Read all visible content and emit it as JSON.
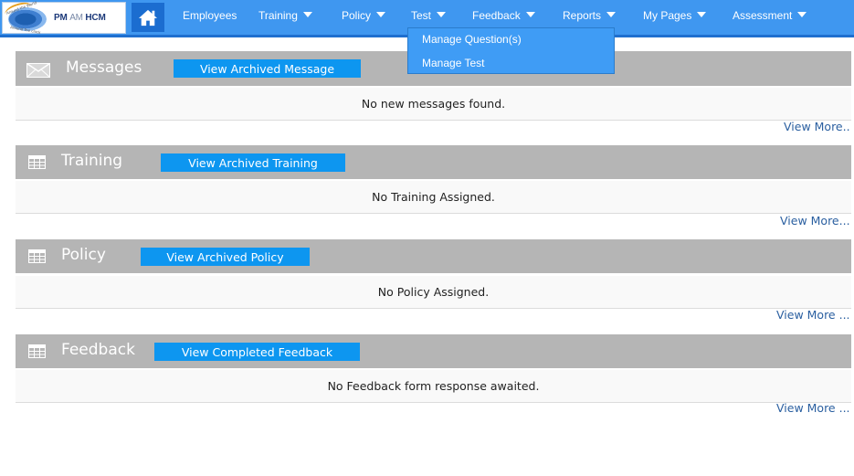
{
  "header": {
    "logo_text_a": "PM",
    "logo_text_b": "AM",
    "logo_text_c": "HCM",
    "logo_tagline_top": "Around the World",
    "logo_tagline_bottom": "Around the clock",
    "nav": [
      {
        "label": "Employees",
        "has_caret": false
      },
      {
        "label": "Training",
        "has_caret": true
      },
      {
        "label": "Policy",
        "has_caret": true
      },
      {
        "label": "Test",
        "has_caret": true
      },
      {
        "label": "Feedback",
        "has_caret": true
      },
      {
        "label": "Reports",
        "has_caret": true
      },
      {
        "label": "My Pages",
        "has_caret": true
      },
      {
        "label": "Assessment",
        "has_caret": true
      }
    ]
  },
  "test_menu": {
    "items": [
      "Manage Question(s)",
      "Manage Test"
    ]
  },
  "panels": {
    "messages": {
      "title": "Messages",
      "button": "View Archived Message",
      "empty_text": "No new messages found.",
      "view_more": "View More.."
    },
    "training": {
      "title": "Training",
      "button": "View Archived Training",
      "empty_text": "No Training Assigned.",
      "view_more": "View More..."
    },
    "policy": {
      "title": "Policy",
      "button": "View Archived Policy",
      "empty_text": "No Policy Assigned.",
      "view_more": "View More ..."
    },
    "feedback": {
      "title": "Feedback",
      "button": "View Completed Feedback",
      "empty_text": "No Feedback form response awaited.",
      "view_more": "View More ..."
    }
  },
  "colors": {
    "nav_bar": "#3f97f0",
    "panel_header": "#b5b5b5",
    "archive_button": "#0d96f0",
    "link": "#2a5fa0"
  },
  "icons": {
    "home": "home-icon",
    "messages": "envelope-icon",
    "section": "table-icon",
    "caret": "caret-down-icon"
  }
}
